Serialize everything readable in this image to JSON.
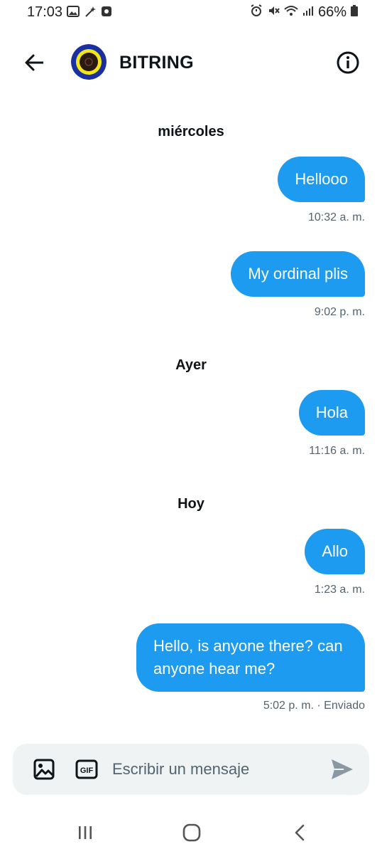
{
  "status_bar": {
    "time": "17:03",
    "battery": "66%",
    "left_icons": [
      "image-notification-icon",
      "magic-wand-icon",
      "record-icon"
    ],
    "right_icons": [
      "alarm-icon",
      "mute-icon",
      "wifi-icon",
      "signal-icon",
      "battery-icon"
    ]
  },
  "header": {
    "title": "BITRING",
    "back_icon": "arrow-left-icon",
    "info_icon": "info-icon",
    "avatar_colors": {
      "outer": "#1a2fa0",
      "ring": "#f2e61a",
      "inner": "#2b1a14"
    }
  },
  "messages": [
    {
      "type": "day",
      "label": "miércoles"
    },
    {
      "type": "msg",
      "text": "Hellooo",
      "time": "10:32 a. m."
    },
    {
      "type": "msg",
      "text": "My ordinal plis",
      "time": "9:02 p. m."
    },
    {
      "type": "day",
      "label": "Ayer"
    },
    {
      "type": "msg",
      "text": "Hola",
      "time": "11:16 a. m."
    },
    {
      "type": "day",
      "label": "Hoy"
    },
    {
      "type": "msg",
      "text": "Allo",
      "time": "1:23 a. m."
    },
    {
      "type": "msg",
      "text": "Hello, is anyone there? can anyone hear me?",
      "time": "5:02 p. m. · Enviado"
    }
  ],
  "composer": {
    "placeholder": "Escribir un mensaje",
    "gif_label": "GIF"
  },
  "colors": {
    "accent": "#1d9bf0",
    "muted_text": "#536471",
    "composer_bg": "#eff3f4"
  }
}
